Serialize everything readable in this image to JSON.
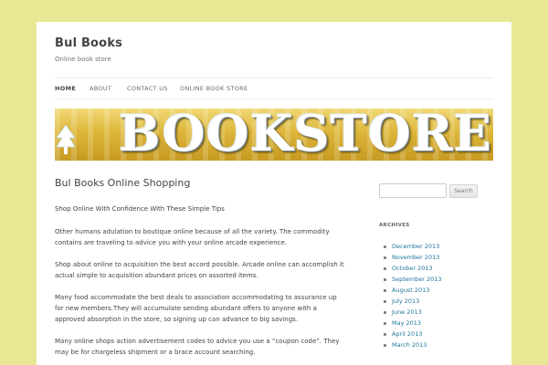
{
  "site": {
    "title": "Bul Books",
    "description": "Online book store"
  },
  "nav": {
    "items": [
      {
        "label": "HOME",
        "active": true
      },
      {
        "label": "ABOUT"
      },
      {
        "label": "CONTACT US"
      },
      {
        "label": "ONLINE BOOK STORE"
      }
    ]
  },
  "banner": {
    "text": "BOOKSTORE"
  },
  "post": {
    "title": "Bul Books Online Shopping",
    "paragraphs": [
      "Shop Online With Confidence With These Simple Tips",
      "Other humans adulation to boutique online because of all the variety. The commodity contains are traveling to advice you with your online arcade experience.",
      "Shop about online to acquisition the best accord possible. Arcade online can accomplish it actual simple to acquisition abundant prices on assorted items.",
      "Many food accommodate the best deals to association accommodating to assurance up for new members.They will accumulate sending abundant offers to anyone with a approved absorption in the store, so signing up can advance to big savings.",
      "Many online shops action advertisement codes to advice you use a “coupon code”. They may be for chargeless shipment or a brace account searching."
    ]
  },
  "sidebar": {
    "search": {
      "value": "",
      "button_label": "Search"
    },
    "archives_title": "ARCHIVES",
    "archives": [
      "December 2013",
      "November 2013",
      "October 2013",
      "September 2013",
      "August 2013",
      "July 2013",
      "June 2013",
      "May 2013",
      "April 2013",
      "March 2013"
    ]
  },
  "colors": {
    "page_background": "#e8e894",
    "link": "#21759b",
    "text": "#444444"
  }
}
